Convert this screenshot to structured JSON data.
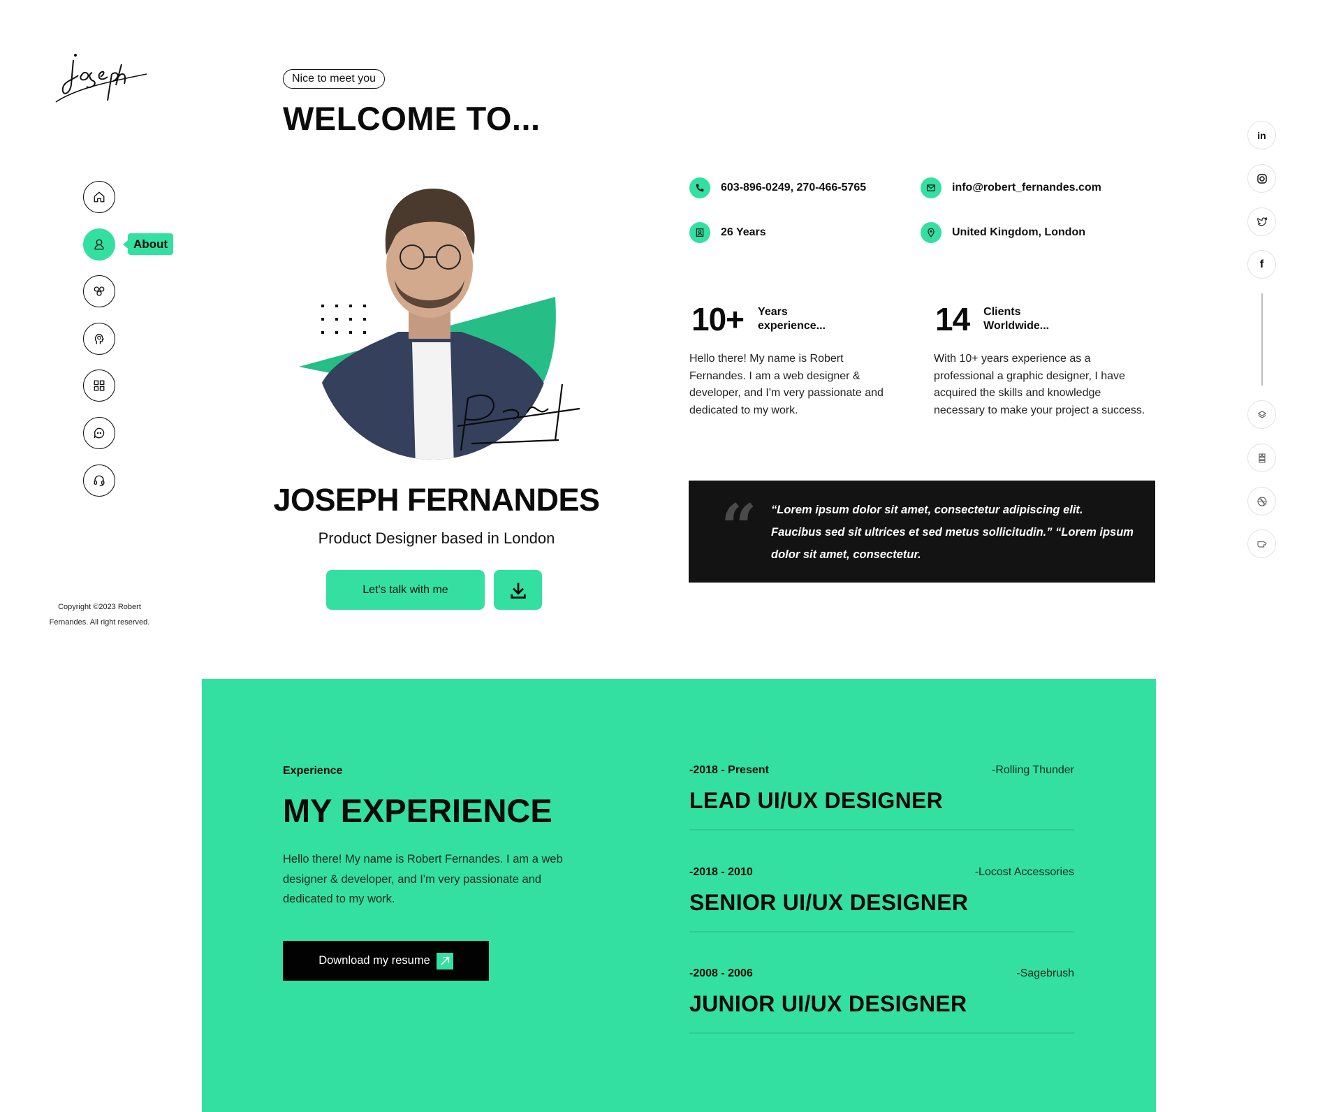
{
  "brand": {
    "logo_text": "joseph",
    "accent_color": "#33e0a1",
    "dark_color": "#141314"
  },
  "sidebar": {
    "items": [
      {
        "icon": "home-icon",
        "label": "Home",
        "active": false
      },
      {
        "icon": "user-icon",
        "label": "About",
        "active": true
      },
      {
        "icon": "gears-icon",
        "label": "Services",
        "active": false
      },
      {
        "icon": "idea-head-icon",
        "label": "Skills",
        "active": false
      },
      {
        "icon": "grid-icon",
        "label": "Portfolio",
        "active": false
      },
      {
        "icon": "chat-icon",
        "label": "Testimonials",
        "active": false
      },
      {
        "icon": "headset-icon",
        "label": "Contact",
        "active": false
      }
    ],
    "tooltip": "About",
    "copyright_line1": "Copyright ©2023 Robert",
    "copyright_line2": "Fernandes. All right reserved."
  },
  "hero": {
    "badge": "Nice to meet you",
    "heading": "WELCOME TO...",
    "portrait_signature": "Robert",
    "name": "JOSEPH FERNANDES",
    "role": "Product Designer based in London",
    "talk_button": "Let’s talk with me",
    "download_icon": "download-icon"
  },
  "contact": {
    "phone": "603-896-0249, 270-466-5765",
    "email": "info@robert_fernandes.com",
    "age": "26 Years",
    "location": "United Kingdom, London"
  },
  "stats": [
    {
      "number": "10+",
      "label_line1": "Years",
      "label_line2": "experience...",
      "text": "Hello there! My name is Robert Fernandes. I am a web designer & developer, and I'm very passionate and dedicated to my work."
    },
    {
      "number": "14",
      "label_line1": "Clients",
      "label_line2": "Worldwide...",
      "text": "With 10+ years experience as a professional a graphic designer, I have acquired the skills and knowledge necessary to make your project a success."
    }
  ],
  "quote": {
    "mark": "“",
    "text": "“Lorem ipsum dolor sit amet, consectetur adipiscing elit. Faucibus sed sit ultrices et sed metus sollicitudin.” “Lorem ipsum dolor sit amet, consectetur."
  },
  "social": {
    "top": [
      {
        "icon": "linkedin-icon",
        "text": "in"
      },
      {
        "icon": "instagram-icon"
      },
      {
        "icon": "twitter-icon"
      },
      {
        "icon": "facebook-icon",
        "text": "f"
      }
    ],
    "bottom": [
      {
        "icon": "layers-icon"
      },
      {
        "icon": "qr-grid-icon"
      },
      {
        "icon": "dribbble-icon"
      },
      {
        "icon": "hand-pointer-icon"
      }
    ]
  },
  "experience": {
    "eyebrow": "Experience",
    "title": "MY EXPERIENCE",
    "text": "Hello there! My name is Robert Fernandes. I am a web designer & developer, and I'm very passionate and dedicated to my work.",
    "resume_button": "Download my resume",
    "jobs": [
      {
        "dates": "-2018 - Present",
        "company": "-Rolling Thunder",
        "title": "LEAD UI/UX DESIGNER"
      },
      {
        "dates": "-2018 - 2010",
        "company": "-Locost Accessories",
        "title": "SENIOR UI/UX DESIGNER"
      },
      {
        "dates": "-2008 - 2006",
        "company": "-Sagebrush",
        "title": "JUNIOR UI/UX DESIGNER"
      }
    ]
  }
}
